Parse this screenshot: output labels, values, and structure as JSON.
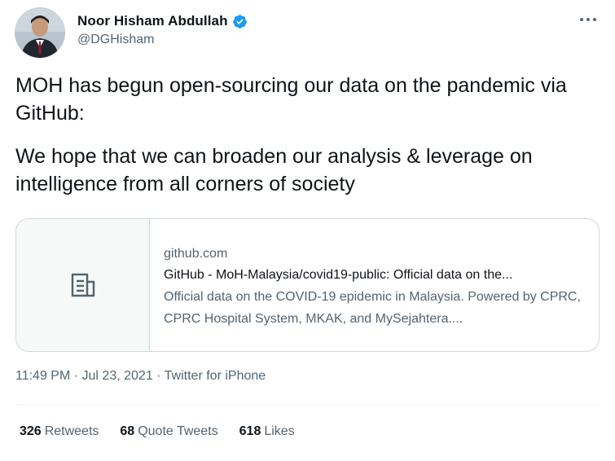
{
  "author": {
    "name": "Noor Hisham Abdullah",
    "handle": "@DGHisham",
    "verified": true
  },
  "tweet": {
    "paragraphs": [
      "MOH has begun open-sourcing our data on the pandemic via GitHub:",
      "We hope that we can broaden our analysis & leverage on intelligence from all corners of society"
    ]
  },
  "card": {
    "domain": "github.com",
    "title": "GitHub - MoH-Malaysia/covid19-public: Official data on the...",
    "description": "Official data on the COVID-19 epidemic in Malaysia. Powered by CPRC, CPRC Hospital System, MKAK, and MySejahtera....",
    "thumb_icon": "document-icon"
  },
  "meta": {
    "time": "11:49 PM",
    "date": "Jul 23, 2021",
    "separator": "·",
    "source": "Twitter for iPhone"
  },
  "stats": {
    "retweets": {
      "count": "326",
      "label": "Retweets"
    },
    "quotes": {
      "count": "68",
      "label": "Quote Tweets"
    },
    "likes": {
      "count": "618",
      "label": "Likes"
    }
  },
  "colors": {
    "text": "#0f1419",
    "secondary": "#536471",
    "verified": "#1d9bf0",
    "border": "#cfd9de"
  }
}
